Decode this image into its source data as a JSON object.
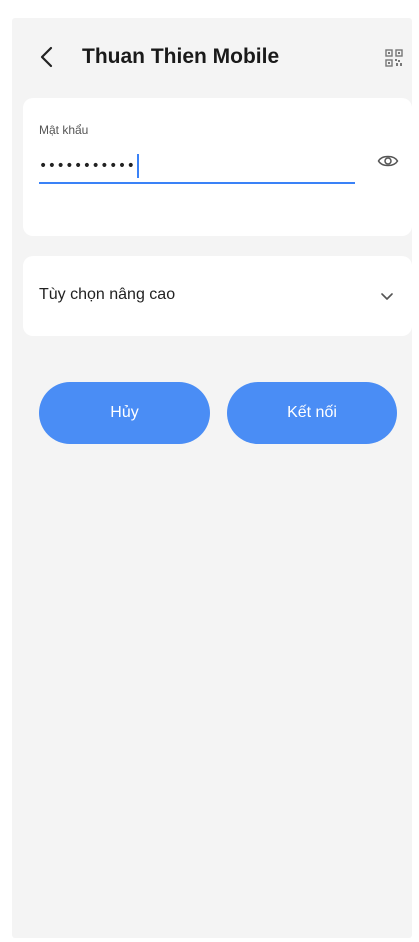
{
  "header": {
    "title": "Thuan Thien Mobile",
    "back_icon": "chevron-left-icon",
    "qr_icon": "qr-code-icon"
  },
  "password": {
    "label": "Mật khẩu",
    "value": "•••••••••••",
    "visibility_icon": "eye-icon"
  },
  "advanced": {
    "label": "Tùy chọn nâng cao",
    "expand_icon": "chevron-down-icon"
  },
  "actions": {
    "cancel_label": "Hủy",
    "connect_label": "Kết nối"
  },
  "colors": {
    "accent": "#4a8df5",
    "focus_underline": "#3a82f7",
    "background": "#f4f4f4",
    "card": "#ffffff"
  }
}
